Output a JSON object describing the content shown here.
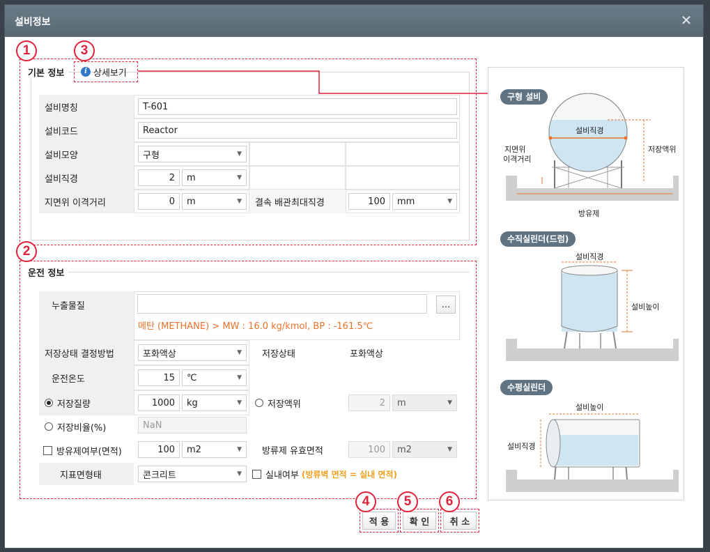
{
  "window": {
    "title": "설비정보",
    "close_icon": "✕"
  },
  "markers": [
    "1",
    "2",
    "3",
    "4",
    "5",
    "6"
  ],
  "basic": {
    "group_title": "기본 정보",
    "detail_link": "상세보기",
    "rows": {
      "name_label": "설비명칭",
      "name_value": "T-601",
      "code_label": "설비코드",
      "code_value": "Reactor",
      "shape_label": "설비모양",
      "shape_value": "구형",
      "diameter_label": "설비직경",
      "diameter_value": "2",
      "diameter_unit": "m",
      "height_label": "지면위 이격거리",
      "height_value": "0",
      "height_unit": "m",
      "pipe_label": "결속 배관최대직경",
      "pipe_value": "100",
      "pipe_unit": "mm"
    }
  },
  "operation": {
    "group_title": "운전 정보",
    "leak_label": "누출물질",
    "leak_value": "",
    "leak_browse": "...",
    "leak_info": "메탄 (METHANE) > MW : 16.0 kg/kmol, BP : -161.5℃",
    "storage_method_label": "저장상태 결정방법",
    "storage_method_value": "포화액상",
    "storage_state_label": "저장상태",
    "storage_state_value": "포화액상",
    "temp_label": "운전온도",
    "temp_value": "15",
    "temp_unit": "℃",
    "mass_label": "저장질량",
    "mass_value": "1000",
    "mass_unit": "kg",
    "level_label": "저장액위",
    "level_value": "2",
    "level_unit": "m",
    "ratio_label": "저장비율(%)",
    "ratio_value": "NaN",
    "dike_label": "방유제여부(면적)",
    "dike_value": "100",
    "dike_unit": "m2",
    "dike_area_label": "방류제 유효면적",
    "dike_area_value": "100",
    "dike_area_unit": "m2",
    "surface_label": "지표면형태",
    "surface_value": "콘크리트",
    "indoor_label": "실내여부",
    "indoor_note": "(방류벽 면적 = 실내 면적)"
  },
  "buttons": {
    "apply": "적 용",
    "ok": "확 인",
    "cancel": "취 소"
  },
  "diagrams": {
    "sphere": {
      "title": "구형 설비",
      "diameter": "설비직경",
      "level": "저장액위",
      "height_line1": "지면위",
      "height_line2": "이격거리",
      "dike": "방유제"
    },
    "vertical": {
      "title": "수직실린더(드럼)",
      "diameter": "설비직경",
      "height": "설비높이"
    },
    "horizontal": {
      "title": "수평실린더",
      "height": "설비높이",
      "diameter": "설비직경"
    }
  },
  "colors": {
    "accent_red": "#e0223a",
    "info_orange": "#e8722a",
    "title_bar": "#5f707c",
    "liquid": "#cfe6f2"
  }
}
